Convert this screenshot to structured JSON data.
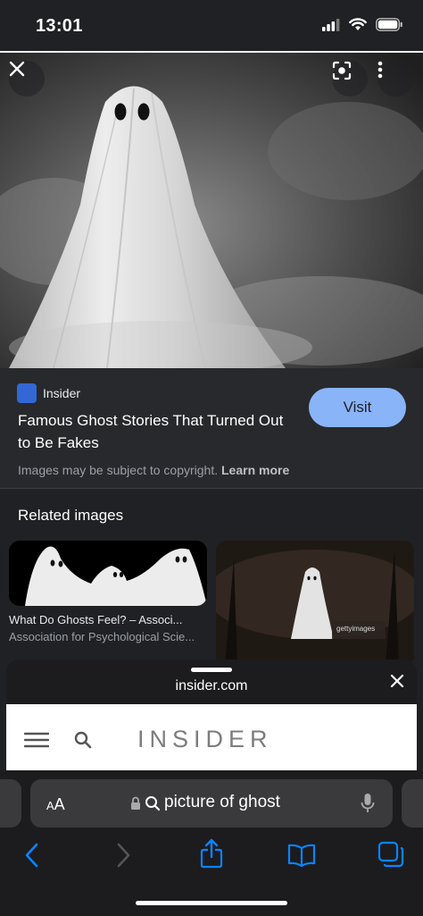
{
  "status_bar": {
    "time": "13:01"
  },
  "source": {
    "site_name": "Insider",
    "title": "Famous Ghost Stories That Turned Out to Be Fakes",
    "visit_label": "Visit",
    "copyright_text": "Images may be subject to copyright.",
    "learn_more_label": "Learn more"
  },
  "related": {
    "heading": "Related images",
    "items": [
      {
        "title": "What Do Ghosts Feel? – Associ...",
        "source": "Association for Psychological Scie..."
      }
    ],
    "watermark": "gettyimages"
  },
  "sheet": {
    "url": "insider.com",
    "site_logo_text": "INSIDER"
  },
  "browser": {
    "aa_small": "A",
    "aa_large": "A",
    "search_query": "picture of ghost"
  },
  "colors": {
    "accent": "#8ab4f8",
    "safari_blue": "#0a84ff",
    "background": "#202124"
  }
}
